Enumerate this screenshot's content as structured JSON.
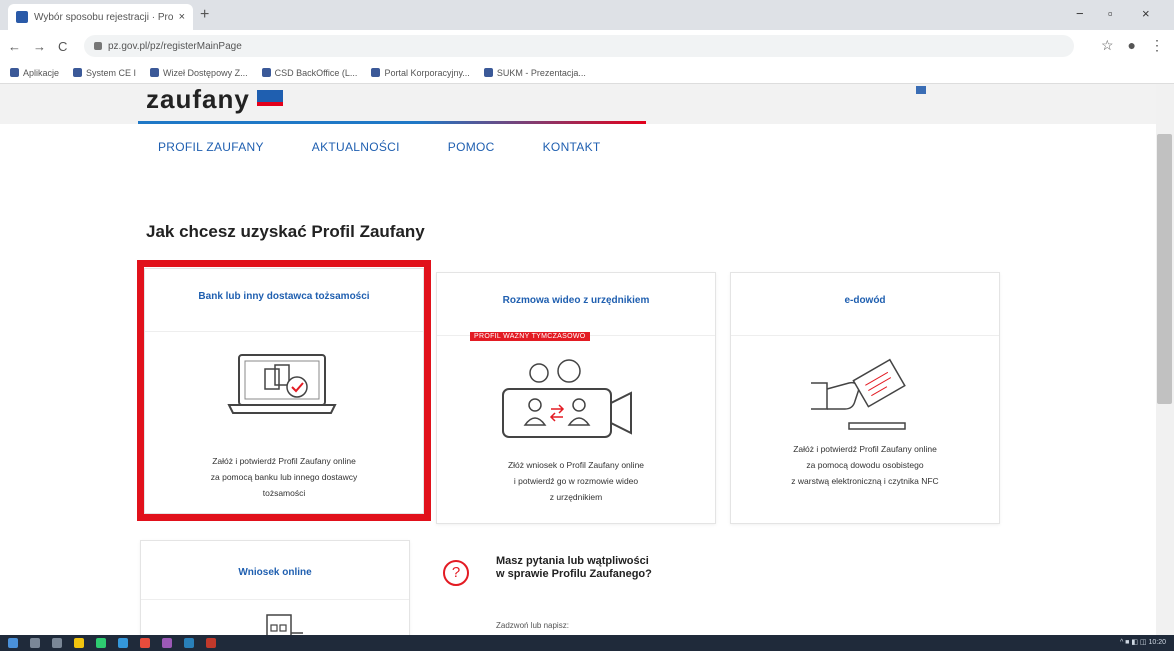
{
  "browser": {
    "tab_title": "Wybór sposobu rejestracji · Prof",
    "tab_close": "×",
    "new_tab": "+",
    "win_min": "−",
    "win_max": "▫",
    "win_close": "×",
    "nav_back": "←",
    "nav_forward": "→",
    "nav_reload": "C",
    "url": "pz.gov.pl/pz/registerMainPage",
    "star": "☆",
    "account": "●",
    "menu": "⋮",
    "bookmarks": [
      "Aplikacje",
      "System CE I",
      "Wizeł Dostępowy Z...",
      "CSD BackOffice (L...",
      "Portal Korporacyjny...",
      "SUKM - Prezentacja..."
    ]
  },
  "site": {
    "logo": "zaufany",
    "nav": [
      "PROFIL ZAUFANY",
      "AKTUALNOŚCI",
      "POMOC",
      "KONTAKT"
    ],
    "page_title": "Jak chcesz uzyskać Profil Zaufany"
  },
  "cards": [
    {
      "title": "Bank lub inny dostawca tożsamości",
      "desc": [
        "Załóż i potwierdź Profil Zaufany online",
        "za pomocą banku lub innego dostawcy",
        "tożsamości"
      ]
    },
    {
      "title": "Rozmowa wideo z urzędnikiem",
      "badge": "PROFIL WAŻNY TYMCZASOWO",
      "desc": [
        "Złóż wniosek o Profil Zaufany online",
        "i potwierdź go w rozmowie wideo",
        "z urzędnikiem"
      ]
    },
    {
      "title": "e-dowód",
      "desc": [
        "Załóż i potwierdź Profil Zaufany online",
        "za pomocą dowodu osobistego",
        "z warstwą elektroniczną i czytnika NFC"
      ]
    },
    {
      "title": "Wniosek online"
    }
  ],
  "faq": {
    "icon": "?",
    "title_line1": "Masz pytania lub wątpliwości",
    "title_line2": "w sprawie Profilu Zaufanego?",
    "sub": "Zadzwoń lub napisz:"
  },
  "taskbar": {
    "tray": "^ ■ ◧ ◫ 10:20"
  },
  "colors": {
    "accent_blue": "#1f5fb0",
    "accent_red": "#e1111b"
  }
}
